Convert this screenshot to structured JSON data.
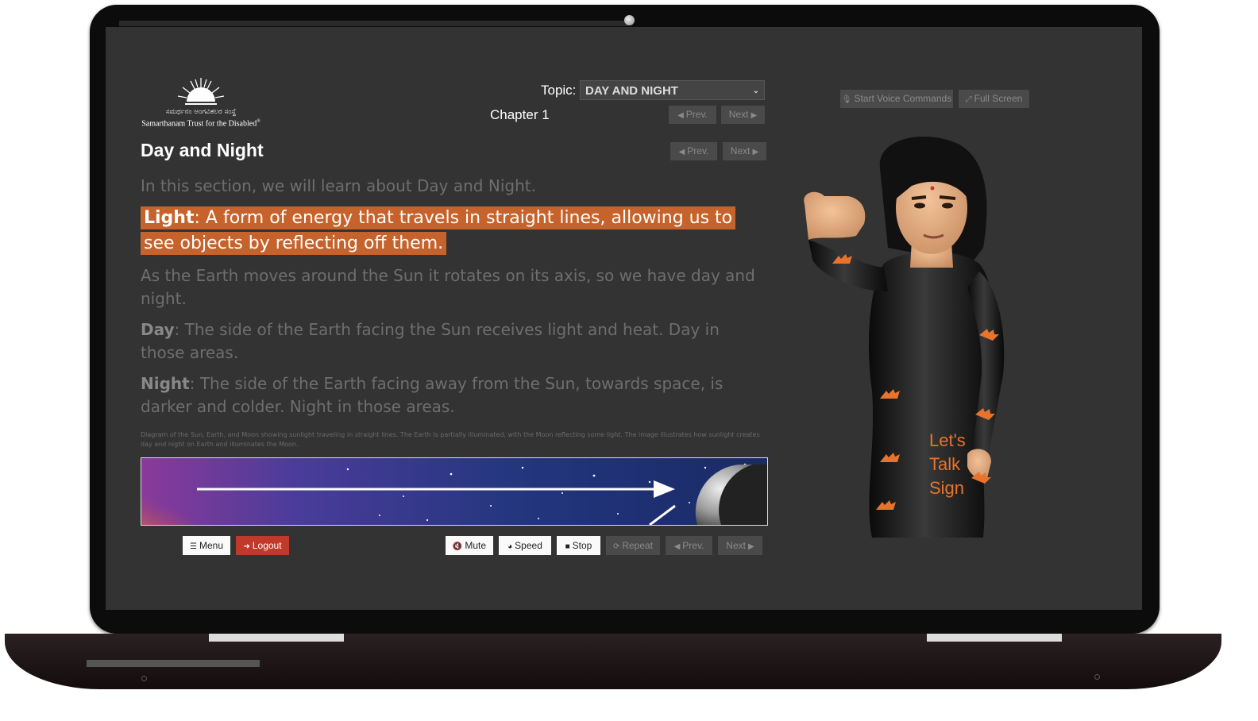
{
  "logo": {
    "line_kannada": "ಸಮರ್ಥನಂ ಅಂಗವಿಕಲರ ಸಂಸ್ಥೆ",
    "line_english": "Samarthanam Trust for the Disabled",
    "trademark": "®"
  },
  "topic": {
    "label": "Topic:",
    "selected": "DAY AND NIGHT"
  },
  "chapter": "Chapter 1",
  "chapter_nav": {
    "prev": "Prev.",
    "next": "Next"
  },
  "section_nav": {
    "prev": "Prev.",
    "next": "Next"
  },
  "right_toolbar": {
    "voice": "Start Voice Commands",
    "fullscreen": "Full Screen"
  },
  "page_title": "Day and Night",
  "paragraphs": {
    "intro": "In this section, we will learn about Day and Night.",
    "light_term": "Light",
    "light_text": ": A form of energy that travels in straight lines, allowing us to see objects by reflecting off them.",
    "rotation": "As the Earth moves around the Sun it rotates on its axis, so we have day and night.",
    "day_term": "Day",
    "day_text": ": The side of the Earth facing the Sun receives light and heat. Day in those areas.",
    "night_term": "Night",
    "night_text": ": The side of the Earth facing away from the Sun, towards space, is darker and colder. Night in those areas."
  },
  "image_caption": "Diagram of the Sun, Earth, and Moon showing sunlight traveling in straight lines. The Earth is partially illuminated, with the Moon reflecting some light. The image illustrates how sunlight creates day and night on Earth and illuminates the Moon.",
  "bottom_bar": {
    "menu": "Menu",
    "logout": "Logout",
    "mute": "Mute",
    "speed": "Speed",
    "stop": "Stop",
    "repeat": "Repeat",
    "prev": "Prev.",
    "next": "Next"
  },
  "avatar_shirt_text": [
    "Let's",
    "Talk",
    "Sign"
  ],
  "colors": {
    "highlight": "#c6622b",
    "logout": "#c0392b",
    "screen_bg": "#333333"
  }
}
